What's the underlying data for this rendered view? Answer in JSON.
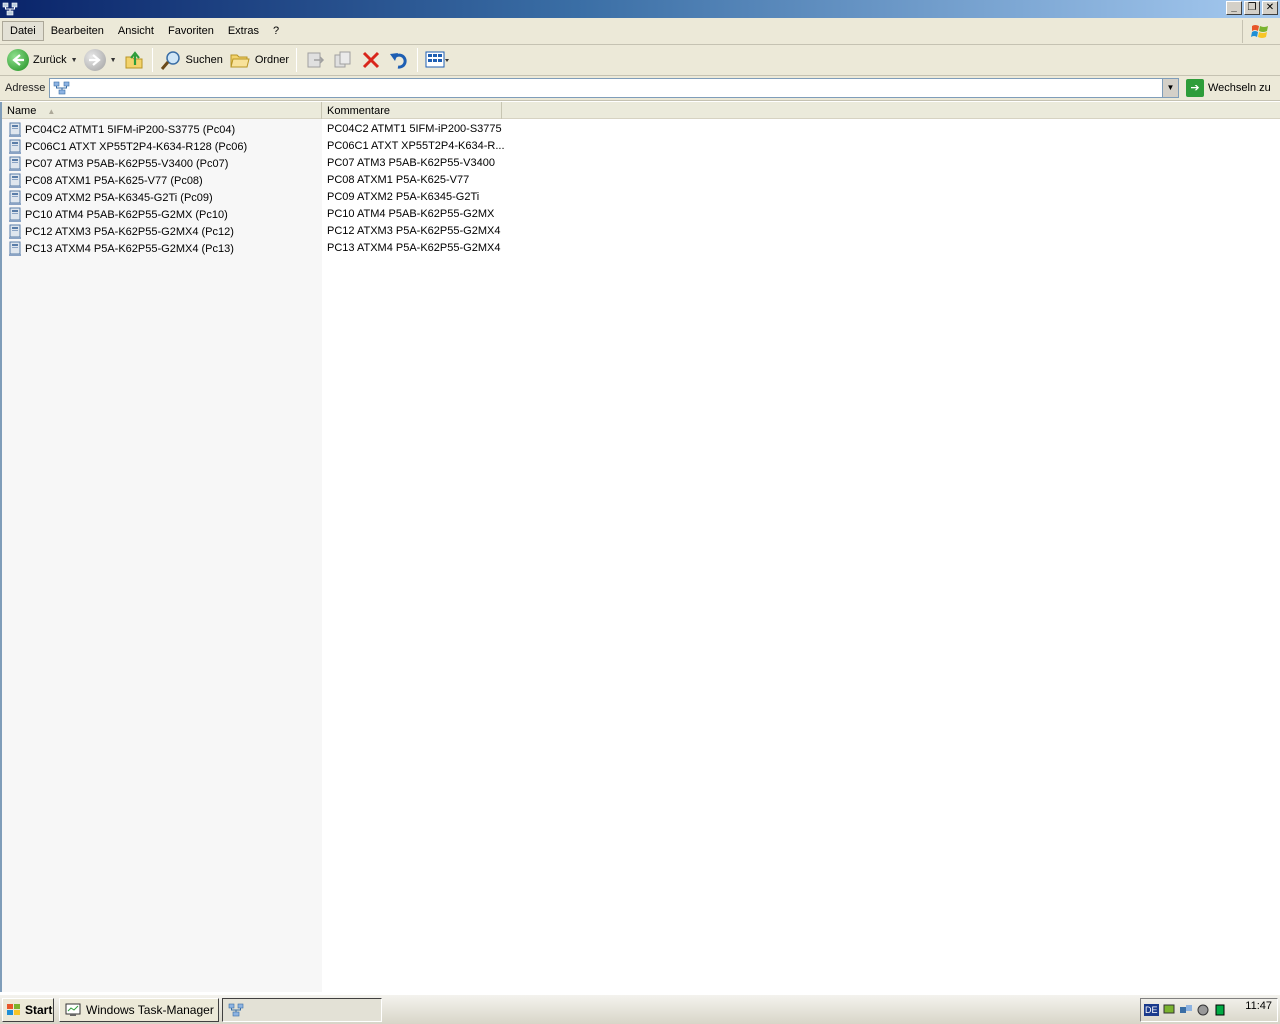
{
  "menu": {
    "items": [
      "Datei",
      "Bearbeiten",
      "Ansicht",
      "Favoriten",
      "Extras",
      "?"
    ]
  },
  "toolbar": {
    "back_label": "Zurück",
    "search_label": "Suchen",
    "folders_label": "Ordner"
  },
  "address": {
    "label": "Adresse",
    "value": "",
    "go_label": "Wechseln zu"
  },
  "list": {
    "columns": [
      "Name",
      "Kommentare"
    ],
    "rows": [
      {
        "name": "PC04C2 ATMT1 5IFM-iP200-S3775 (Pc04)",
        "comment": "PC04C2 ATMT1 5IFM-iP200-S3775"
      },
      {
        "name": "PC06C1 ATXT XP55T2P4-K634-R128 (Pc06)",
        "comment": "PC06C1 ATXT XP55T2P4-K634-R..."
      },
      {
        "name": "PC07 ATM3 P5AB-K62P55-V3400 (Pc07)",
        "comment": "PC07 ATM3 P5AB-K62P55-V3400"
      },
      {
        "name": "PC08 ATXM1 P5A-K625-V77 (Pc08)",
        "comment": "PC08 ATXM1 P5A-K625-V77"
      },
      {
        "name": "PC09 ATXM2 P5A-K6345-G2Ti (Pc09)",
        "comment": "PC09 ATXM2 P5A-K6345-G2Ti"
      },
      {
        "name": "PC10 ATM4 P5AB-K62P55-G2MX (Pc10)",
        "comment": "PC10 ATM4 P5AB-K62P55-G2MX"
      },
      {
        "name": "PC12 ATXM3 P5A-K62P55-G2MX4 (Pc12)",
        "comment": "PC12 ATXM3 P5A-K62P55-G2MX4"
      },
      {
        "name": "PC13 ATXM4 P5A-K62P55-G2MX4 (Pc13)",
        "comment": "PC13 ATXM4 P5A-K62P55-G2MX4"
      }
    ]
  },
  "taskbar": {
    "start_label": "Start",
    "tasks": [
      "Windows Task-Manager",
      ""
    ],
    "language": "DE",
    "clock": "11:47"
  }
}
